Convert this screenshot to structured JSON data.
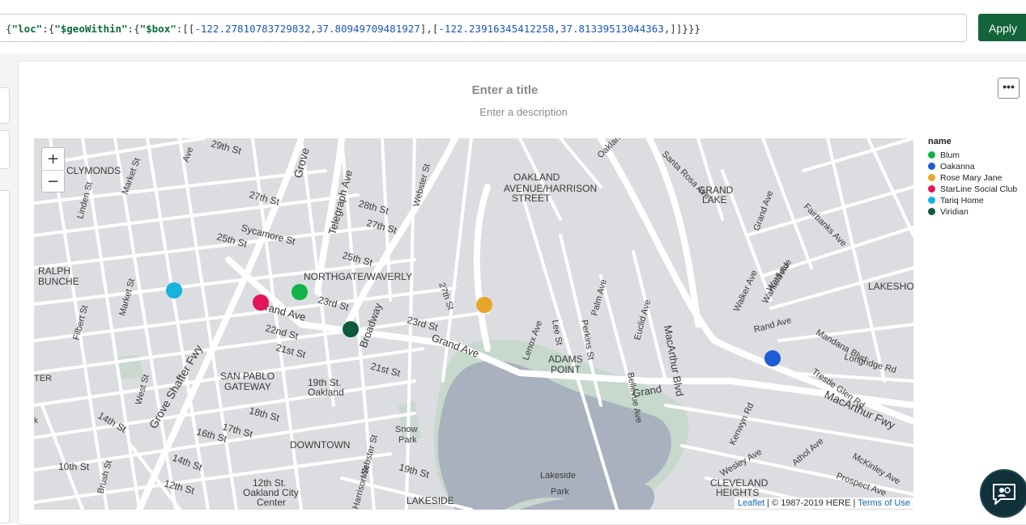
{
  "query": {
    "k_loc": "\"loc\"",
    "k_geo": "\"$geoWithin\"",
    "k_box": "\"$box\"",
    "n1": "-122.27810783729832",
    "n2": "37.80949709481927",
    "n3": "-122.23916345412258",
    "n4": "37.81339513044363"
  },
  "apply_label": "Apply",
  "chart": {
    "title": "Enter a title",
    "description": "Enter a description",
    "more_label": "•••"
  },
  "map": {
    "zoom_in": "+",
    "zoom_out": "−",
    "attribution": {
      "leaflet": "Leaflet",
      "copyright": " | © 1987-2019 HERE | ",
      "terms": "Terms of Use"
    },
    "labels": [
      {
        "text": "CLYMONDS"
      },
      {
        "text": "OAKLAND"
      },
      {
        "text": "AVENUE/HARRISON"
      },
      {
        "text": "STREET"
      },
      {
        "text": "GRAND"
      },
      {
        "text": "LAKE"
      },
      {
        "text": "RALPH"
      },
      {
        "text": "BUNCHE"
      },
      {
        "text": "NORTHGATE/WAVERLY"
      },
      {
        "text": "LAKESHOR"
      },
      {
        "text": "ADAMS"
      },
      {
        "text": "POINT"
      },
      {
        "text": "SAN PABLO"
      },
      {
        "text": "GATEWAY"
      },
      {
        "text": "19th St."
      },
      {
        "text": "Oakland"
      },
      {
        "text": "DOWNTOWN"
      },
      {
        "text": "Snow"
      },
      {
        "text": "Park"
      },
      {
        "text": "12th St."
      },
      {
        "text": "Oakland City"
      },
      {
        "text": "Center"
      },
      {
        "text": "LAKESIDE"
      },
      {
        "text": "Lakeside"
      },
      {
        "text": "Park"
      },
      {
        "text": "CLEVELAND"
      },
      {
        "text": "HEIGHTS"
      },
      {
        "text": "Grove"
      },
      {
        "text": "Telegraph Ave"
      },
      {
        "text": "Broadway"
      },
      {
        "text": "Grand Ave"
      },
      {
        "text": "Grand Ave"
      },
      {
        "text": "Grand"
      },
      {
        "text": "Grove Shafter Fwy"
      },
      {
        "text": "MacArthur Blvd"
      },
      {
        "text": "MacArthur Fwy"
      },
      {
        "text": "27th St"
      },
      {
        "text": "28th St"
      },
      {
        "text": "27th St"
      },
      {
        "text": "25th St"
      },
      {
        "text": "25th St"
      },
      {
        "text": "23rd St"
      },
      {
        "text": "23rd St"
      },
      {
        "text": "22nd St"
      },
      {
        "text": "21st St"
      },
      {
        "text": "21st St"
      },
      {
        "text": "18th St"
      },
      {
        "text": "17th St"
      },
      {
        "text": "16th St"
      },
      {
        "text": "14th St"
      },
      {
        "text": "14th St"
      },
      {
        "text": "10th St"
      },
      {
        "text": "12th St"
      },
      {
        "text": "19th St"
      },
      {
        "text": "29th St"
      },
      {
        "text": "Sycamore St"
      },
      {
        "text": "Market St"
      },
      {
        "text": "Market St"
      },
      {
        "text": "Linden St"
      },
      {
        "text": "Filbert St"
      },
      {
        "text": "West St"
      },
      {
        "text": "Webster St"
      },
      {
        "text": "Webster St"
      },
      {
        "text": "Harrison St"
      },
      {
        "text": "27th St"
      },
      {
        "text": "Perkins St"
      },
      {
        "text": "Palm Ave"
      },
      {
        "text": "Euclid Ave"
      },
      {
        "text": "Bellevue Ave"
      },
      {
        "text": "Lee St"
      },
      {
        "text": "Lenox Ave"
      },
      {
        "text": "Grand Ave"
      },
      {
        "text": "Walker Ave"
      },
      {
        "text": "Warfield Ave"
      },
      {
        "text": "Rand Ave"
      },
      {
        "text": "Mandana Blvd"
      },
      {
        "text": "Longridge Rd"
      },
      {
        "text": "Trestle Glen Rd"
      },
      {
        "text": "Fairbanks Ave"
      },
      {
        "text": "Athol Ave"
      },
      {
        "text": "McKinley Ave"
      },
      {
        "text": "Prospect Ave"
      },
      {
        "text": "Wesley Ave"
      },
      {
        "text": "Kenwyn Rd"
      },
      {
        "text": "Oakland Ave"
      },
      {
        "text": "Santa Rosa Ave"
      },
      {
        "text": "Brush St"
      },
      {
        "text": "Ave"
      },
      {
        "text": "Warfield"
      },
      {
        "text": "ll"
      },
      {
        "text": "k"
      },
      {
        "text": "TER"
      }
    ]
  },
  "legend": {
    "title": "name",
    "items": [
      {
        "label": "Blum",
        "color": "#13b24a"
      },
      {
        "label": "Oakanna",
        "color": "#1f5bd6"
      },
      {
        "label": "Rose Mary Jane",
        "color": "#e8a628"
      },
      {
        "label": "StarLine Social Club",
        "color": "#e3145b"
      },
      {
        "label": "Tariq Home",
        "color": "#17b2de"
      },
      {
        "label": "Viridian",
        "color": "#0d5a3a"
      }
    ]
  },
  "markers": [
    {
      "name": "Blum",
      "color": "#13b24a"
    },
    {
      "name": "Oakanna",
      "color": "#1f5bd6"
    },
    {
      "name": "Rose Mary Jane",
      "color": "#e8a628"
    },
    {
      "name": "StarLine Social Club",
      "color": "#e3145b"
    },
    {
      "name": "Tariq Home",
      "color": "#17b2de"
    },
    {
      "name": "Viridian",
      "color": "#0d5a3a"
    }
  ]
}
